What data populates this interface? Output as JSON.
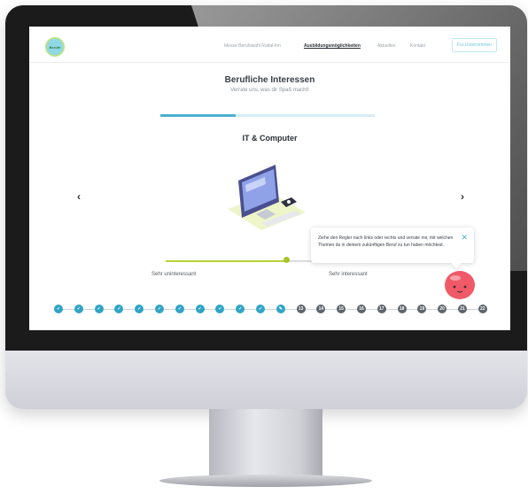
{
  "nav": {
    "logo_text": "Berufe",
    "links": [
      "Messe Berufswahl Rottal-Inn",
      "Ausbildungsmöglichkeiten",
      "Aktuelles",
      "Kontakt"
    ],
    "cta": "Für Unternehmen"
  },
  "section": {
    "title": "Berufliche Interessen",
    "subtitle": "Verrate uns, was dir Spaß macht!",
    "progress": 0.35,
    "category": "IT & Computer"
  },
  "arrows": {
    "prev": "‹",
    "next": "›"
  },
  "slider": {
    "value": 0.68,
    "left_label": "Sehr uninteressant",
    "right_label": "Sehr interessant"
  },
  "tooltip": {
    "text": "Ziehe den Regler nach links oder rechts und verrate mir, mit welchen Themen du in deinem zukünftigen Beruf zu tun haben möchtest.",
    "close": "✕"
  },
  "steps": {
    "done_icon": "✓",
    "current_icon": "✎",
    "numbers": [
      "13",
      "14",
      "15",
      "16",
      "17",
      "18",
      "19",
      "20",
      "21",
      "22"
    ]
  },
  "colors": {
    "accent": "#2fa4c7",
    "slider": "#a6c52a",
    "todo": "#5d646c"
  }
}
